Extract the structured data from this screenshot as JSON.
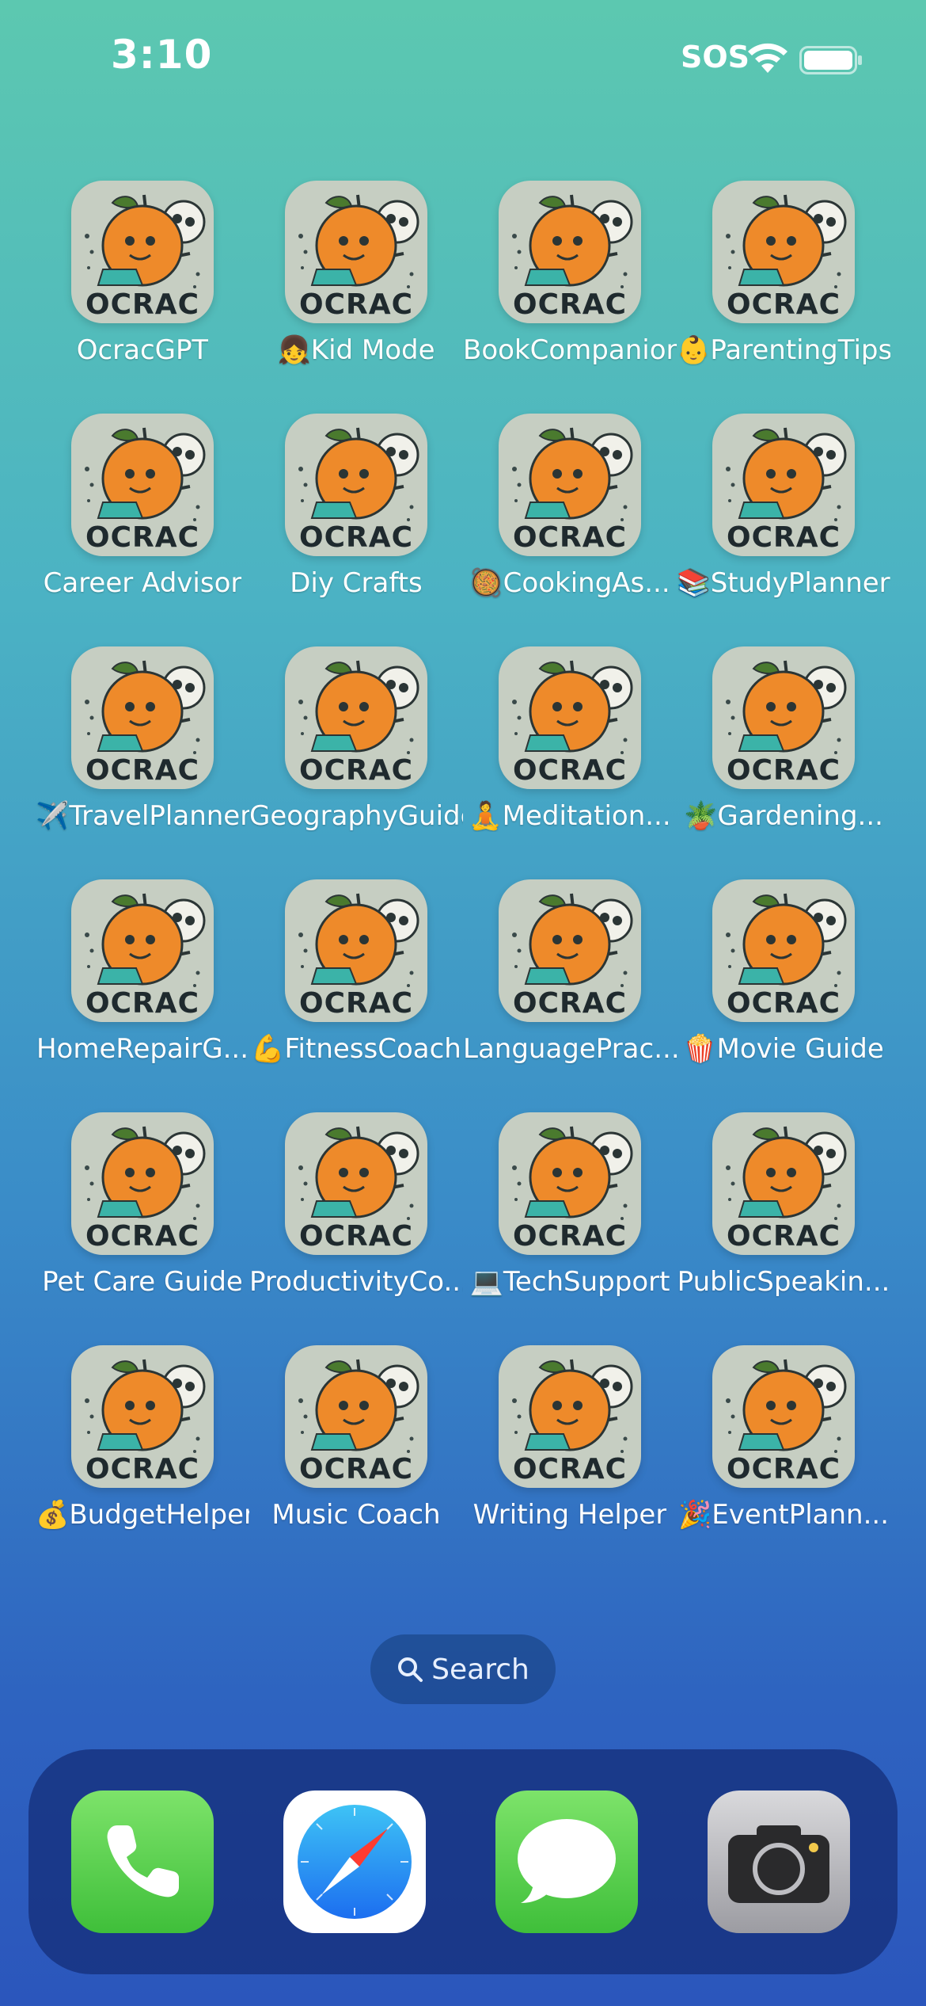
{
  "status_bar": {
    "time": "3:10",
    "carrier": "SOS",
    "wifi_icon": "wifi-icon",
    "battery_icon": "battery-icon"
  },
  "apps": [
    {
      "label": "OcracGPT"
    },
    {
      "label": "👧Kid Mode"
    },
    {
      "label": "BookCompanion"
    },
    {
      "label": "👶ParentingTips"
    },
    {
      "label": "Career Advisor"
    },
    {
      "label": "Diy Crafts"
    },
    {
      "label": "🥘CookingAs..."
    },
    {
      "label": "📚StudyPlanner"
    },
    {
      "label": "✈️TravelPlanner"
    },
    {
      "label": "GeographyGuide"
    },
    {
      "label": "🧘Meditation..."
    },
    {
      "label": "🪴Gardening..."
    },
    {
      "label": "HomeRepairG..."
    },
    {
      "label": "💪FitnessCoach"
    },
    {
      "label": "LanguagePrac..."
    },
    {
      "label": "🍿Movie Guide"
    },
    {
      "label": "Pet Care Guide"
    },
    {
      "label": "ProductivityCo..."
    },
    {
      "label": "💻TechSupport"
    },
    {
      "label": "PublicSpeakin..."
    },
    {
      "label": "💰BudgetHelper"
    },
    {
      "label": "Music Coach"
    },
    {
      "label": "Writing Helper"
    },
    {
      "label": "🎉EventPlann..."
    }
  ],
  "app_icon_text": "OCRAC",
  "search": {
    "label": "Search",
    "icon": "search-icon"
  },
  "dock": [
    {
      "name": "phone",
      "icon": "phone-icon"
    },
    {
      "name": "safari",
      "icon": "compass-icon"
    },
    {
      "name": "messages",
      "icon": "message-bubble-icon"
    },
    {
      "name": "camera",
      "icon": "camera-icon"
    }
  ],
  "colors": {
    "icon_bg": "#c6cec2",
    "orange": "#ee8a2a",
    "leaf": "#4a7a2e",
    "text_dark": "#1f2a2e",
    "phone_green": "#5fd54e",
    "messages_green": "#5fd54e"
  }
}
